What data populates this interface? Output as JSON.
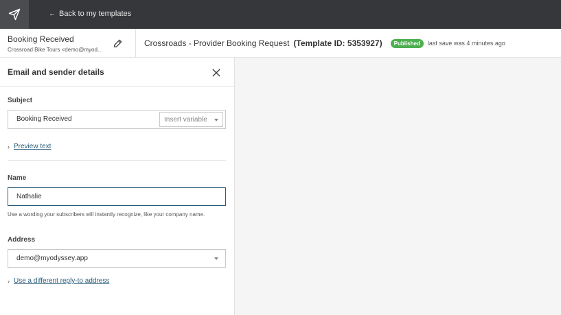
{
  "topbar": {
    "logo_icon": "paper-plane-icon",
    "back_label": "Back to my templates"
  },
  "header": {
    "template_name": "Booking Received",
    "sender": "Crossroad Bike Tours <demo@myodyssey.app>",
    "title": "Crossroads - Provider Booking Request",
    "template_id": "(Template ID: 5353927)",
    "status_badge": "Published",
    "last_save": "last save was 4 minutes ago",
    "badge_color": "#4caf50"
  },
  "panel": {
    "title": "Email and sender details",
    "subject": {
      "label": "Subject",
      "value": "Booking Received",
      "insert_variable": "Insert variable"
    },
    "preview_text_link": "Preview text",
    "name": {
      "label": "Name",
      "value": "Nathalie",
      "hint": "Use a wording your subscribers will instantly recognize, like your company name."
    },
    "address": {
      "label": "Address",
      "value": "demo@myodyssey.app"
    },
    "reply_to_link": "Use a different reply-to address"
  }
}
